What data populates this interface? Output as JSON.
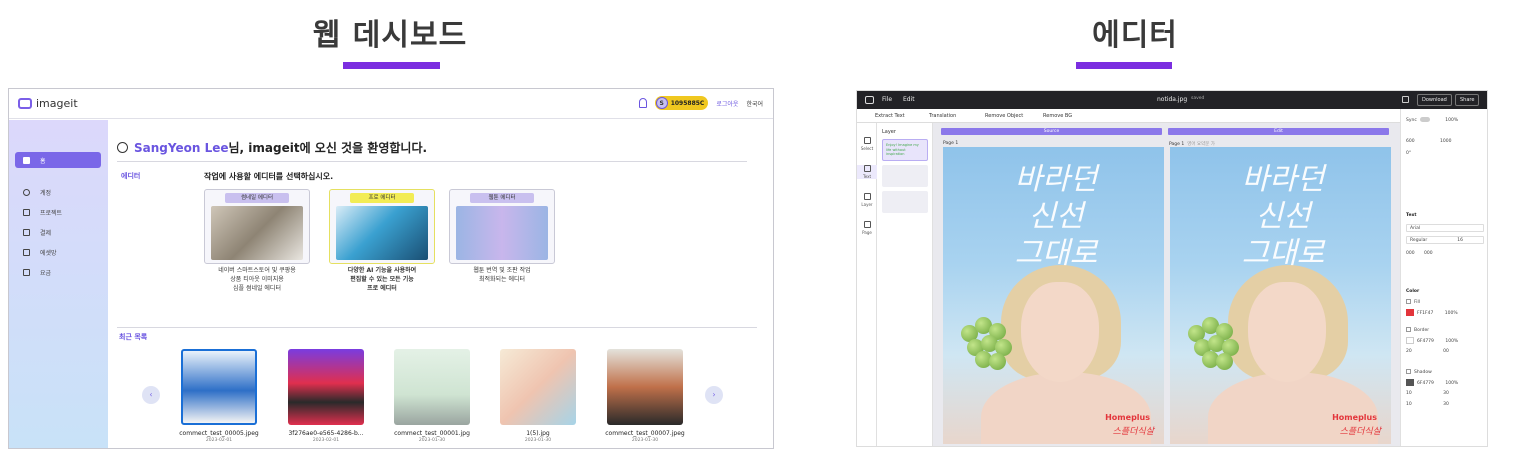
{
  "headings": {
    "dashboard": "웹 데시보드",
    "editor": "에디터"
  },
  "colors": {
    "accent": "#7b2ee0",
    "brand": "#7a67e8",
    "credit": "#f0c820",
    "poster_red": "#e3353b"
  },
  "dashboard": {
    "logo": "imageit",
    "topbar": {
      "avatar_initial": "S",
      "credits": "1095885C",
      "logout": "로그아웃",
      "language": "한국어"
    },
    "sidebar": [
      {
        "label": "홈",
        "icon": "home-icon",
        "active": true
      },
      {
        "label": "계정",
        "icon": "user-icon",
        "active": false
      },
      {
        "label": "프로젝트",
        "icon": "project-icon",
        "active": false
      },
      {
        "label": "결제",
        "icon": "card-icon",
        "active": false
      },
      {
        "label": "에셋망",
        "icon": "asset-icon",
        "active": false
      },
      {
        "label": "요금",
        "icon": "pricing-icon",
        "active": false
      }
    ],
    "welcome": {
      "user": "SangYeon Lee",
      "message": "님, imageit에 오신 것을 환영합니다."
    },
    "editors_label": "에디터",
    "choose_text": "작업에 사용할 에디터를 선택하십시오.",
    "editor_cards": [
      {
        "tag": "썸네일 에디터",
        "desc": [
          "네이버 스마트스토어 및 쿠팡용",
          "상품 티아웃 이미지용",
          "심플 썸네일 에디터"
        ],
        "bold": false
      },
      {
        "tag": "프로 에디터",
        "desc": [
          "다양한 AI 기능을 사용하여",
          "편집할 수 있는 모든 기능",
          "프로 에디터"
        ],
        "bold": true
      },
      {
        "tag": "웹툰 에디터",
        "desc": [
          "웹툰 번역 및 조판 작업",
          "최적화되는 에디터"
        ],
        "bold": false
      }
    ],
    "recent_label": "최근 목록",
    "recent_items": [
      {
        "name": "commect_test_00005.jpeg",
        "date": "2023-02-01"
      },
      {
        "name": "3f276ae0-e565-4286-b...",
        "date": "2023-02-01"
      },
      {
        "name": "commect_test_00001.jpg",
        "date": "2023-01-30"
      },
      {
        "name": "1(5).jpg",
        "date": "2023-01-30"
      },
      {
        "name": "commect_test_00007.jpeg",
        "date": "2023-01-30"
      }
    ],
    "prev_arrow": "‹",
    "next_arrow": "›"
  },
  "editor": {
    "menu": {
      "file": "File",
      "edit": "Edit"
    },
    "filename": "notida.jpg",
    "saved": "saved",
    "download": "Download",
    "share": "Share",
    "tools": [
      "Extract Text",
      "Translation",
      "Remove Object",
      "Remove BG"
    ],
    "left_tools": [
      "Select",
      "Text",
      "Layer",
      "Page"
    ],
    "layer_title": "Layer",
    "layer_text": "Enjoy! Imagine my life without inspiration",
    "panes": {
      "left": "Source",
      "right": "Edit"
    },
    "page_label": "Page 1",
    "page_sub": "영어 요약문 가",
    "poster": {
      "calligraphy": [
        "바라던",
        "신선",
        "그대로"
      ],
      "brand": "Homeplus",
      "brand_sub": "스플더식살"
    },
    "props": {
      "sync_label": "Sync",
      "zoom": "100%",
      "w": "600",
      "h": "1000",
      "rotation": "0°",
      "text_section": "Text",
      "font": "Arial",
      "weight": "Regular",
      "size": "16",
      "spacing_a": "000",
      "spacing_b": "000",
      "color_section": "Color",
      "fill_label": "Fill",
      "fill_hex": "FF1F47",
      "fill_opacity": "100%",
      "border_label": "Border",
      "border_hex": "6F4779",
      "border_opacity": "100%",
      "border_w": "20",
      "border_r": "00",
      "shadow_label": "Shadow",
      "shadow_hex": "6F4779",
      "shadow_opacity": "100%",
      "shadow_x": "10",
      "shadow_y": "10",
      "shadow_blur": "30",
      "shadow_spread": "30"
    }
  }
}
